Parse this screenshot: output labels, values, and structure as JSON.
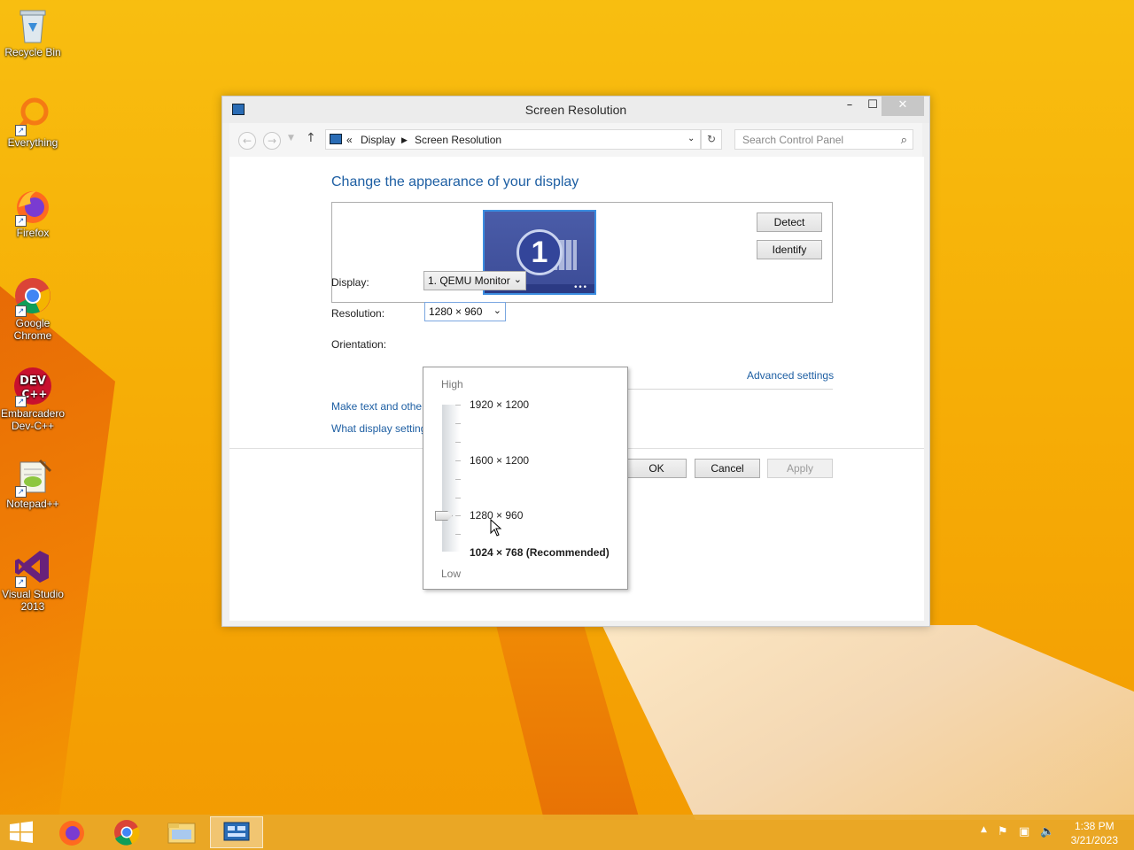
{
  "desktop": {
    "icons": [
      {
        "label": "Recycle Bin"
      },
      {
        "label": "Everything"
      },
      {
        "label": "Firefox"
      },
      {
        "label": "Google Chrome"
      },
      {
        "label": "Embarcadero Dev-C++"
      },
      {
        "label": "Notepad++"
      },
      {
        "label": "Visual Studio 2013"
      }
    ]
  },
  "window": {
    "title": "Screen Resolution",
    "breadcrumb": {
      "prefix": "«",
      "items": [
        "Display",
        "Screen Resolution"
      ]
    },
    "search_placeholder": "Search Control Panel",
    "heading": "Change the appearance of your display",
    "monitor_number": "1",
    "detect_label": "Detect",
    "identify_label": "Identify",
    "display_label": "Display:",
    "display_value": "1. QEMU Monitor",
    "resolution_label": "Resolution:",
    "resolution_value": "1280 × 960",
    "orientation_label": "Orientation:",
    "advanced_link": "Advanced settings",
    "link_text_size": "Make text and other",
    "link_display_settings": "What display setting",
    "ok_label": "OK",
    "cancel_label": "Cancel",
    "apply_label": "Apply"
  },
  "resolution_popup": {
    "high_label": "High",
    "low_label": "Low",
    "options": [
      "1920 × 1200",
      "1600 × 1200",
      "1280 × 960",
      "1024 × 768 (Recommended)"
    ],
    "selected": "1280 × 960"
  },
  "taskbar": {
    "time": "1:38 PM",
    "date": "3/21/2023"
  }
}
